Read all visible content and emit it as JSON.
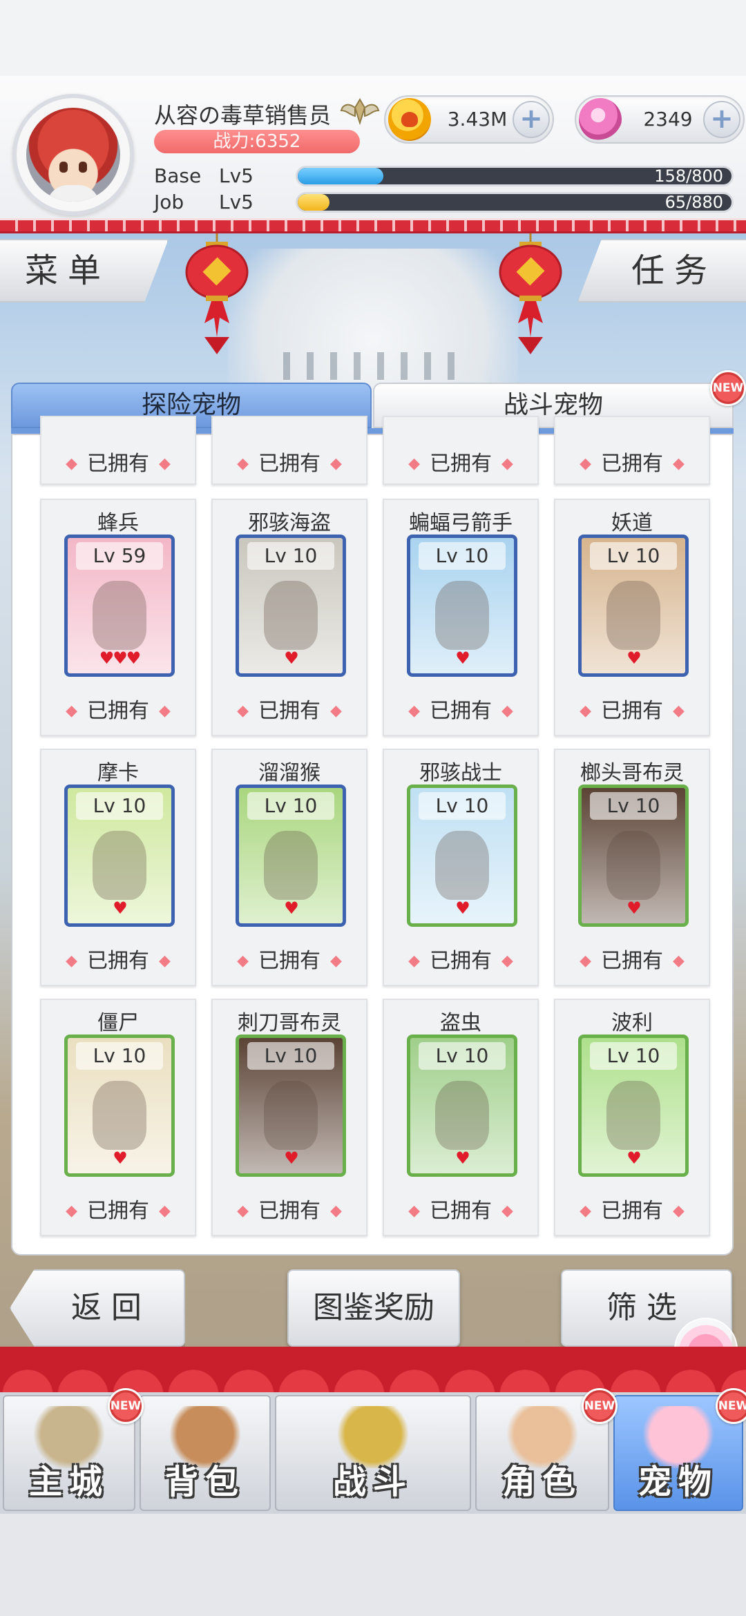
{
  "player": {
    "name": "从容の毒草销售员",
    "power": "战力:6352",
    "gold": "3.43M",
    "gems": "2349",
    "base_label": "Base",
    "base_level": "Lv5",
    "base_exp": "158/800",
    "base_progress": 0.1975,
    "job_label": "Job",
    "job_level": "Lv5",
    "job_exp": "65/880",
    "job_progress": 0.0739
  },
  "buttons": {
    "menu": "菜单",
    "task": "任务",
    "plus": "+",
    "back": "返回",
    "reward": "图鉴奖励",
    "filter": "筛选"
  },
  "tabs": [
    {
      "label": "探险宠物",
      "active": true
    },
    {
      "label": "战斗宠物",
      "active": false,
      "badge": "NEW"
    }
  ],
  "owned_label": "已拥有",
  "pets": [
    {
      "name": "蜂兵",
      "level": "Lv 59",
      "hearts": "♥♥♥",
      "frame": "blue",
      "bg": "#f3b7c7"
    },
    {
      "name": "邪骇海盗",
      "level": "Lv 10",
      "hearts": "♥",
      "frame": "blue",
      "bg": "#c9c7bd"
    },
    {
      "name": "蝙蝠弓箭手",
      "level": "Lv 10",
      "hearts": "♥",
      "frame": "blue",
      "bg": "#a9d3ef"
    },
    {
      "name": "妖道",
      "level": "Lv 10",
      "hearts": "♥",
      "frame": "blue",
      "bg": "#d6b48e"
    },
    {
      "name": "摩卡",
      "level": "Lv 10",
      "hearts": "♥",
      "frame": "blue",
      "bg": "#cfe89e"
    },
    {
      "name": "溜溜猴",
      "level": "Lv 10",
      "hearts": "♥",
      "frame": "blue",
      "bg": "#a9d67e"
    },
    {
      "name": "邪骇战士",
      "level": "Lv 10",
      "hearts": "♥",
      "frame": "green",
      "bg": "#bfe0f3"
    },
    {
      "name": "榔头哥布灵",
      "level": "Lv 10",
      "hearts": "♥",
      "frame": "green",
      "bg": "#5b4335"
    },
    {
      "name": "僵尸",
      "level": "Lv 10",
      "hearts": "♥",
      "frame": "green",
      "bg": "#eadfc0"
    },
    {
      "name": "刺刀哥布灵",
      "level": "Lv 10",
      "hearts": "♥",
      "frame": "green",
      "bg": "#5b4335"
    },
    {
      "name": "盗虫",
      "level": "Lv 10",
      "hearts": "♥",
      "frame": "green",
      "bg": "#9fcf8a"
    },
    {
      "name": "波利",
      "level": "Lv 10",
      "hearts": "♥",
      "frame": "green",
      "bg": "#aee08c"
    }
  ],
  "nav": [
    {
      "label": "主城",
      "badge": "NEW",
      "active": false
    },
    {
      "label": "背包",
      "badge": "",
      "active": false
    },
    {
      "label": "战斗",
      "badge": "",
      "active": false
    },
    {
      "label": "角色",
      "badge": "NEW",
      "active": false
    },
    {
      "label": "宠物",
      "badge": "NEW",
      "active": true
    }
  ],
  "colors": {
    "accent": "#6d99dd",
    "festive_red": "#d82c3a",
    "heart": "#e01b2a"
  }
}
